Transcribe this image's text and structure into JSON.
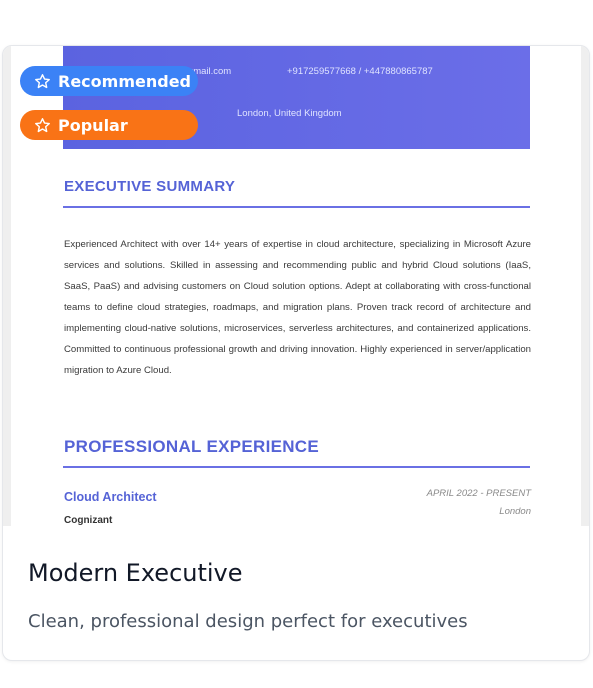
{
  "badges": {
    "recommended": "Recommended",
    "popular": "Popular",
    "icon": "star-outline-icon",
    "recommended_color": "#3b82f6",
    "popular_color": "#f97316"
  },
  "resume": {
    "email": "0@gmail.com",
    "phone": "+917259577668 / +447880865787",
    "location": "London, United Kingdom",
    "summary_heading": "EXECUTIVE SUMMARY",
    "summary_text": "Experienced Architect with over 14+ years of expertise in cloud architecture, specializing in Microsoft Azure services and solutions. Skilled in assessing and recommending public and hybrid Cloud solutions (IaaS, SaaS, PaaS) and advising customers on Cloud solution options. Adept at collaborating with cross-functional teams to define cloud strategies, roadmaps, and migration plans. Proven track record of architecture and implementing cloud-native solutions, microservices, serverless architectures, and containerized applications. Committed to continuous professional growth and driving innovation. Highly experienced in server/application migration to Azure Cloud.",
    "experience_heading": "PROFESSIONAL EXPERIENCE",
    "job": {
      "title": "Cloud Architect",
      "company": "Cognizant",
      "date": "APRIL 2022 - PRESENT",
      "location": "London"
    }
  },
  "template": {
    "name": "Modern Executive",
    "description": "Clean, professional design perfect for executives"
  }
}
